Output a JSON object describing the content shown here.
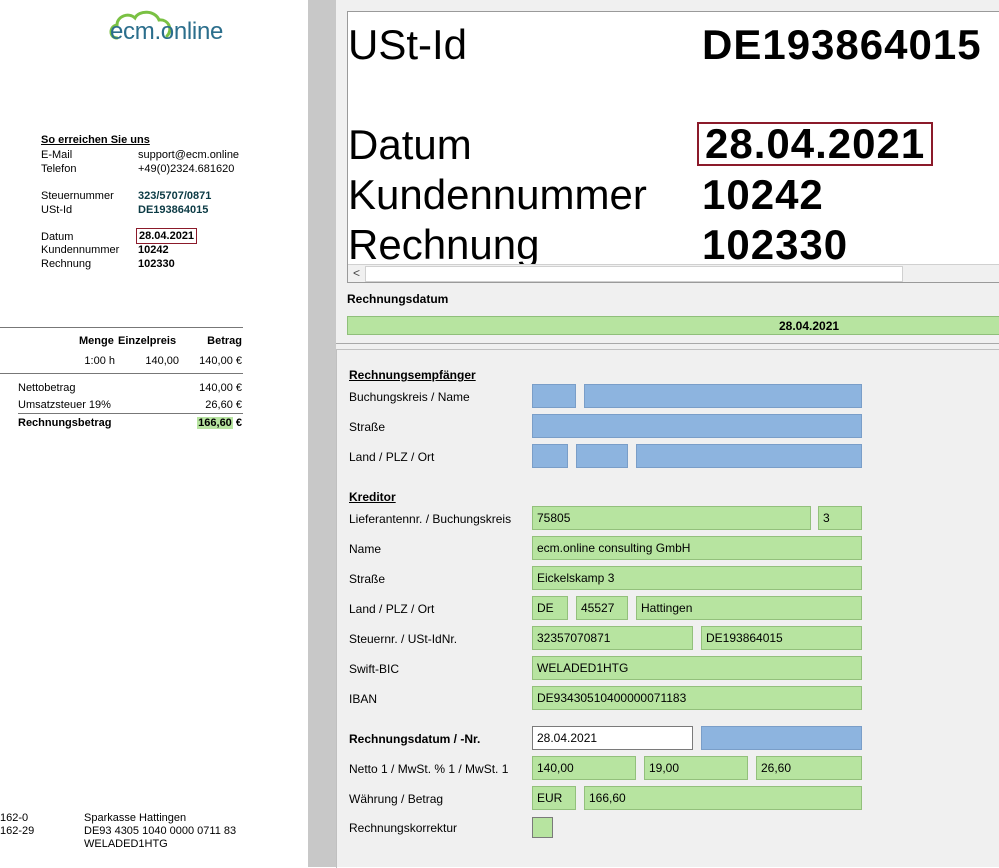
{
  "doc": {
    "logo": "ecm.online",
    "contact_heading": "So erreichen Sie uns",
    "contact": [
      {
        "label": "E-Mail",
        "value": "support@ecm.online"
      },
      {
        "label": "Telefon",
        "value": "+49(0)2324.681620"
      }
    ],
    "tax": [
      {
        "label": "Steuernummer",
        "value": "323/5707/0871"
      },
      {
        "label": "USt-Id",
        "value": "DE193864015"
      }
    ],
    "meta": [
      {
        "label": "Datum",
        "value": "28.04.2021"
      },
      {
        "label": "Kundennummer",
        "value": "10242"
      },
      {
        "label": "Rechnung",
        "value": "102330"
      }
    ],
    "table_headers": {
      "qty": "Menge",
      "unit_price": "Einzelpreis",
      "amount": "Betrag"
    },
    "line_item": {
      "qty": "1:00 h",
      "unit_price": "140,00",
      "amount": "140,00 €"
    },
    "totals": [
      {
        "label": "Nettobetrag",
        "value": "140,00 €"
      },
      {
        "label": "Umsatzsteuer 19%",
        "value": "26,60 €"
      },
      {
        "label": "Rechnungsbetrag",
        "value": "166,60",
        "suffix": " €"
      }
    ],
    "footer": {
      "left1": "162-0",
      "left2": "162-29",
      "bank_name": "Sparkasse Hattingen",
      "iban": "DE93 4305 1040 0000 0711 83",
      "bic": "WELADED1HTG"
    }
  },
  "zoom": {
    "rows": [
      {
        "label": "USt-Id",
        "value": "DE193864015"
      },
      {
        "label": "Datum",
        "value": "28.04.2021"
      },
      {
        "label": "Kundennummer",
        "value": "10242"
      },
      {
        "label": "Rechnung",
        "value": "102330"
      }
    ],
    "scroll_left": "<"
  },
  "field_label": "Rechnungsdatum",
  "field_value": "28.04.2021",
  "form": {
    "recipient": {
      "heading": "Rechnungsempfänger",
      "name_label": "Buchungskreis / Name",
      "street_label": "Straße",
      "country_label": "Land / PLZ / Ort"
    },
    "creditor": {
      "heading": "Kreditor",
      "supplier_label": "Lieferantennr. / Buchungskreis",
      "supplier_no": "75805",
      "company_code": "3",
      "name_label": "Name",
      "name": "ecm.online consulting GmbH",
      "street_label": "Straße",
      "street": "Eickelskamp 3",
      "country_label": "Land / PLZ / Ort",
      "country": "DE",
      "zip": "45527",
      "city": "Hattingen",
      "tax_label": "Steuernr. / USt-IdNr.",
      "tax_no": "32357070871",
      "vat_id": "DE193864015",
      "bic_label": "Swift-BIC",
      "bic": "WELADED1HTG",
      "iban_label": "IBAN",
      "iban": "DE93430510400000071183"
    },
    "invoice": {
      "date_label": "Rechnungsdatum / -Nr.",
      "date": "28.04.2021",
      "netto_label": "Netto 1 / MwSt. % 1 / MwSt. 1",
      "netto": "140,00",
      "vat_pct": "19,00",
      "vat": "26,60",
      "currency_label": "Währung / Betrag",
      "currency": "EUR",
      "amount": "166,60",
      "correction_label": "Rechnungskorrektur"
    }
  },
  "colors": {
    "field_green": "#b7e4a0",
    "field_blue": "#8db4df",
    "highlight_border": "#8b1a2a",
    "logo": "#2b6e8c"
  }
}
